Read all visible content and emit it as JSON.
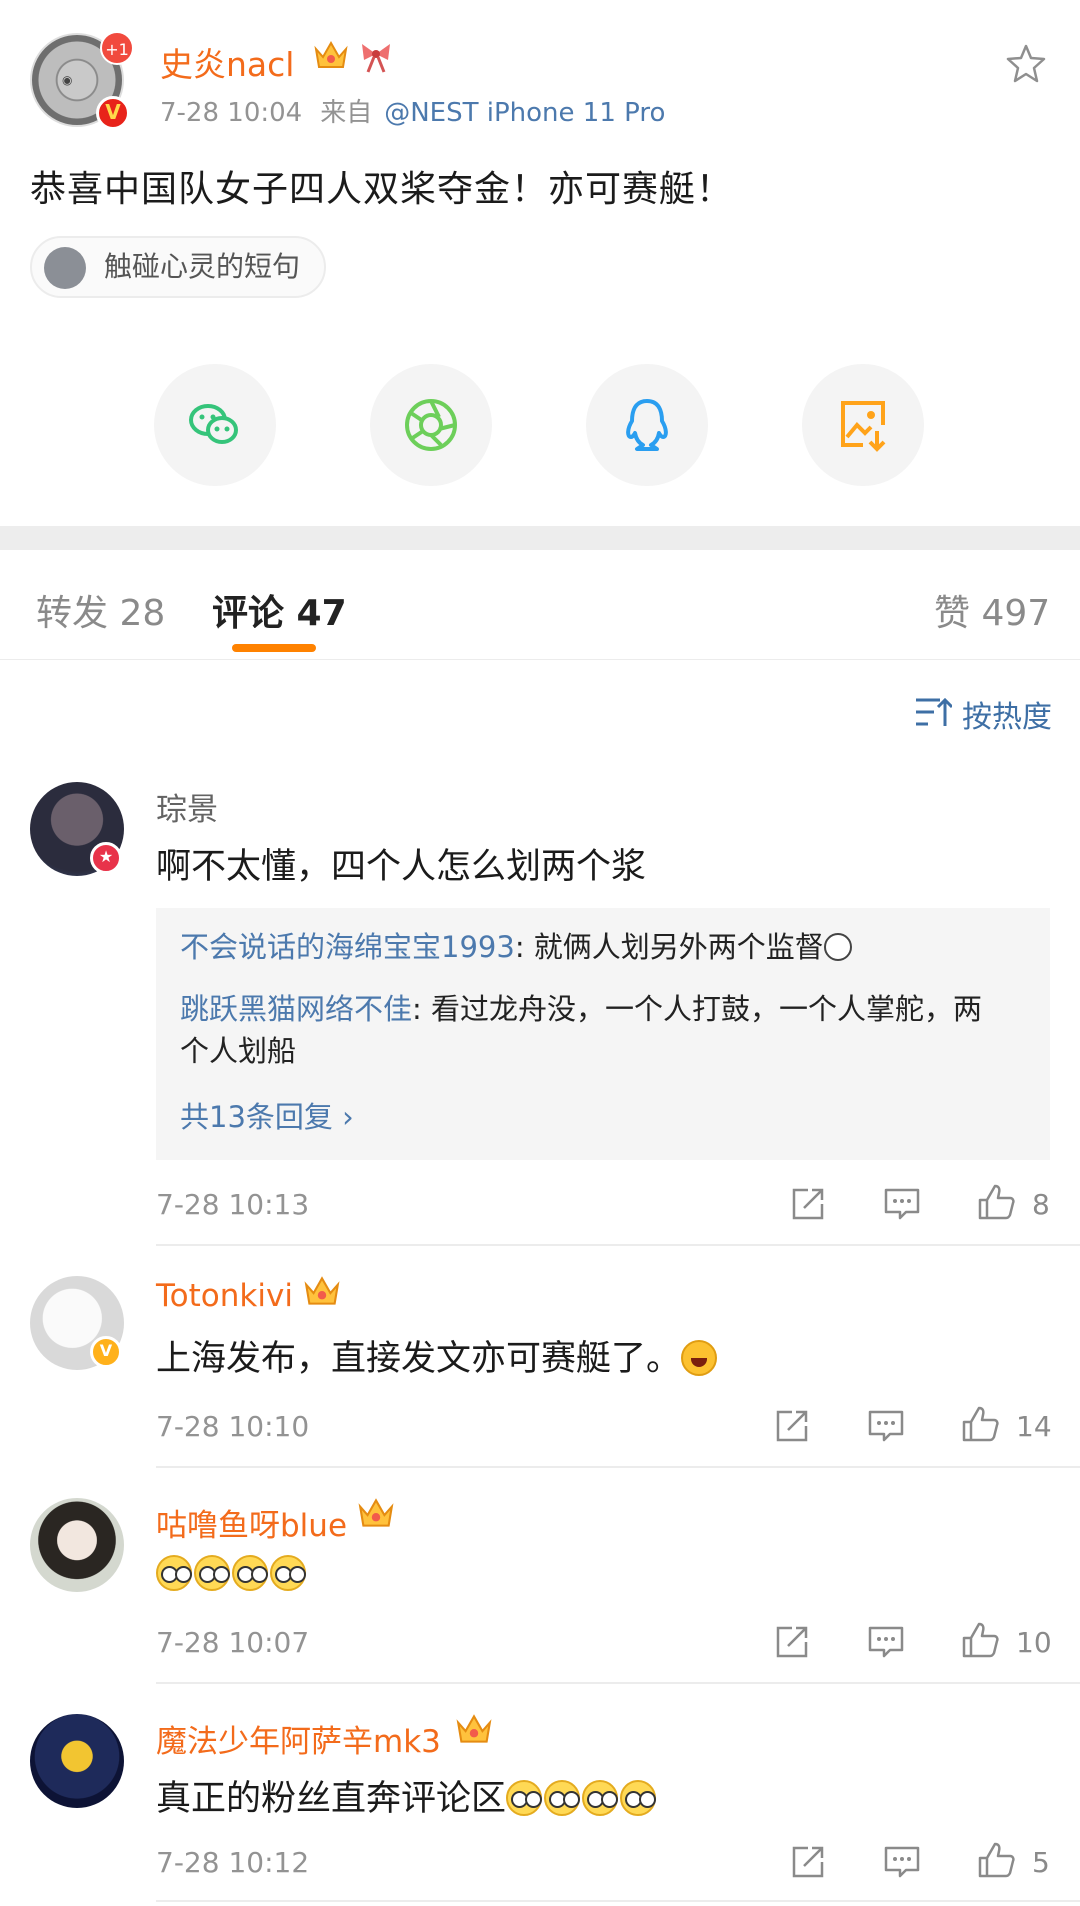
{
  "post": {
    "author": "史炎nacl",
    "plus_badge": "+1",
    "time": "7-28 10:04",
    "from_label": "来自",
    "source": "@NEST iPhone 11 Pro",
    "text": "恭喜中国队女子四人双桨夺金！亦可赛艇！",
    "topic": "触碰心灵的短句",
    "share_targets": [
      "wechat-icon",
      "moments-icon",
      "qq-icon",
      "save-image-icon"
    ]
  },
  "tabs": {
    "repost": "转发 28",
    "comments": "评论 47",
    "likes": "赞 497"
  },
  "sort": {
    "label": "按热度"
  },
  "comments": [
    {
      "name": "琮景",
      "text": "啊不太懂，四个人怎么划两个浆",
      "replies": [
        {
          "user": "不会说话的海绵宝宝1993",
          "text": ": 就俩人划另外两个监督"
        },
        {
          "user": "跳跃黑猫网络不佳",
          "text": ": 看过龙舟没，一个人打鼓，一个人掌舵，两个人划船"
        }
      ],
      "more_replies": "共13条回复 ›",
      "time": "7-28 10:13",
      "likes": "8"
    },
    {
      "name": "Totonkivi",
      "text": "上海发布，直接发文亦可赛艇了。",
      "time": "7-28 10:10",
      "likes": "14"
    },
    {
      "name": "咕噜鱼呀blue",
      "text": "",
      "time": "7-28 10:07",
      "likes": "10"
    },
    {
      "name": "魔法少年阿萨辛mk3",
      "text": "真正的粉丝直奔评论区",
      "time": "7-28 10:12",
      "likes": "5"
    }
  ],
  "colors": {
    "accent_orange": "#ff8200",
    "vip_name": "#f36b1b",
    "link_blue": "#4c79ad"
  }
}
